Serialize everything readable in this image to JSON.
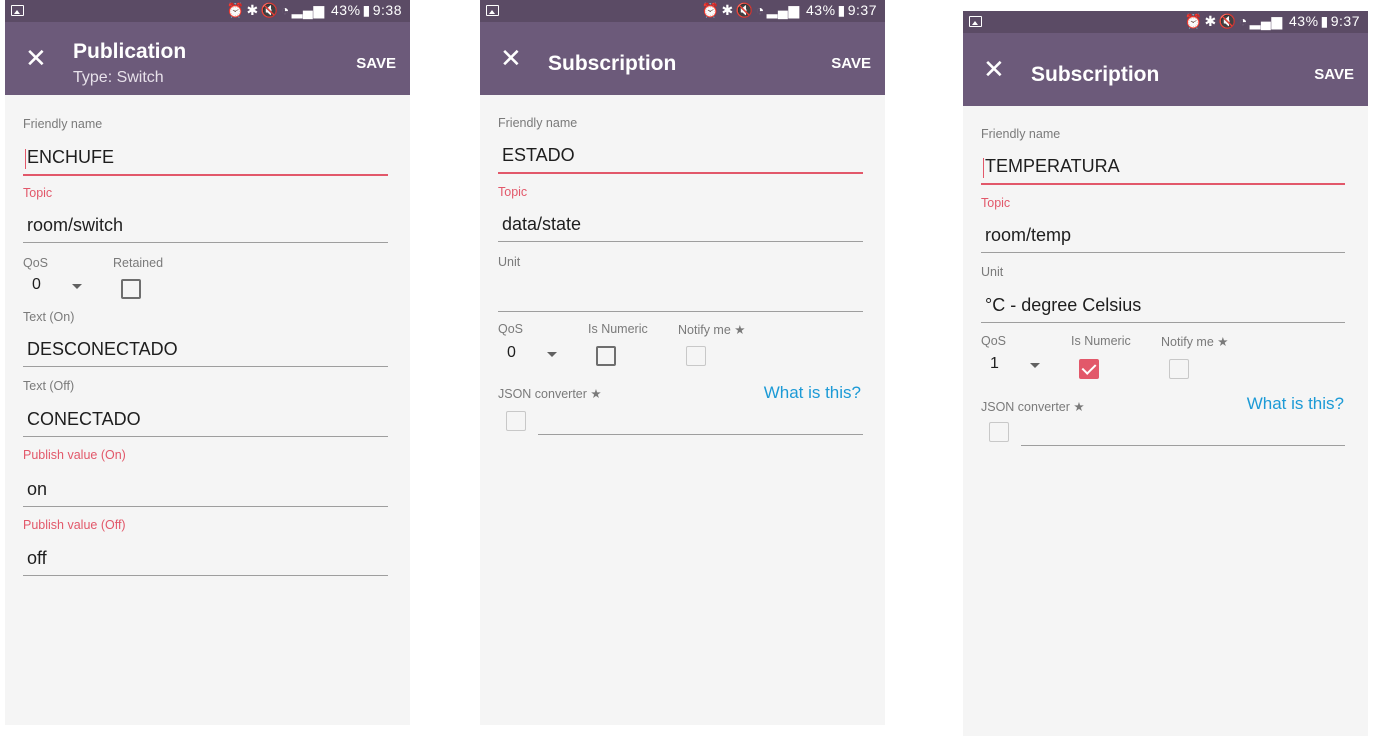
{
  "statusbar": {
    "icons": [
      "image-icon",
      "alarm-icon",
      "bluetooth-icon",
      "mute-icon",
      "wifi-icon",
      "signal-icon",
      "battery-icon"
    ]
  },
  "phone1": {
    "status_battery": "43%",
    "status_time": "9:38",
    "title": "Publication",
    "subtitle": "Type: Switch",
    "save": "SAVE",
    "friendly_label": "Friendly name",
    "friendly_value": "ENCHUFE",
    "topic_label": "Topic",
    "topic_value": "room/switch",
    "qos_label": "QoS",
    "qos_value": "0",
    "retained_label": "Retained",
    "text_on_label": "Text (On)",
    "text_on_value": "DESCONECTADO",
    "text_off_label": "Text (Off)",
    "text_off_value": "CONECTADO",
    "pub_on_label": "Publish value (On)",
    "pub_on_value": "on",
    "pub_off_label": "Publish value (Off)",
    "pub_off_value": "off"
  },
  "phone2": {
    "status_battery": "43%",
    "status_time": "9:37",
    "title": "Subscription",
    "save": "SAVE",
    "friendly_label": "Friendly name",
    "friendly_value": "ESTADO",
    "topic_label": "Topic",
    "topic_value": "data/state",
    "unit_label": "Unit",
    "unit_value": "",
    "qos_label": "QoS",
    "qos_value": "0",
    "numeric_label": "Is Numeric",
    "notify_label": "Notify me ★",
    "json_label": "JSON converter ★",
    "help_link": "What is this?"
  },
  "phone3": {
    "status_battery": "43%",
    "status_time": "9:37",
    "title": "Subscription",
    "save": "SAVE",
    "friendly_label": "Friendly name",
    "friendly_value": "TEMPERATURA",
    "topic_label": "Topic",
    "topic_value": "room/temp",
    "unit_label": "Unit",
    "unit_value": "°C - degree Celsius",
    "qos_label": "QoS",
    "qos_value": "1",
    "numeric_label": "Is Numeric",
    "notify_label": "Notify me ★",
    "json_label": "JSON converter ★",
    "help_link": "What is this?"
  },
  "colors": {
    "statusbar": "#5b4b65",
    "toolbar": "#6c5a7a",
    "accent": "#e2586a",
    "link": "#1c9ad6",
    "background": "#f5f5f5"
  }
}
